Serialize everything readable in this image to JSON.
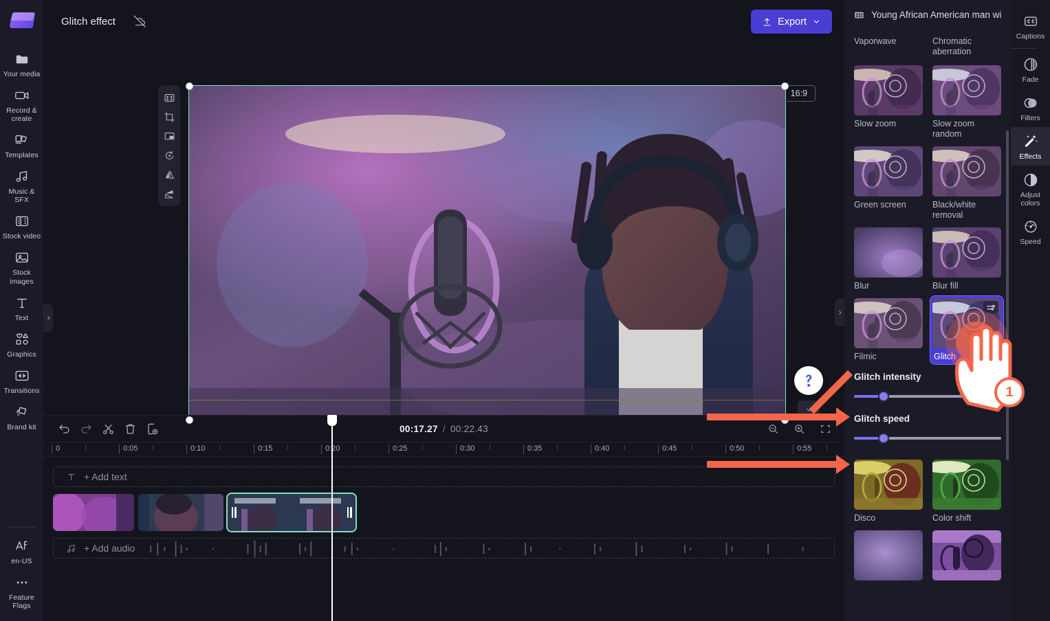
{
  "app": {
    "project_title": "Glitch effect",
    "export_label": "Export",
    "aspect_ratio": "16:9"
  },
  "left_rail": {
    "items": [
      {
        "label": "Your media",
        "icon": "media-folder-icon"
      },
      {
        "label": "Record & create",
        "icon": "video-camera-icon"
      },
      {
        "label": "Templates",
        "icon": "templates-icon"
      },
      {
        "label": "Music & SFX",
        "icon": "music-note-icon"
      },
      {
        "label": "Stock video",
        "icon": "film-strip-icon"
      },
      {
        "label": "Stock images",
        "icon": "image-icon"
      },
      {
        "label": "Text",
        "icon": "text-t-icon"
      },
      {
        "label": "Graphics",
        "icon": "shapes-icon"
      },
      {
        "label": "Transitions",
        "icon": "transitions-icon"
      },
      {
        "label": "Brand kit",
        "icon": "brand-kit-icon"
      }
    ],
    "bottom_items": [
      {
        "label": "en-US",
        "icon": "language-icon"
      },
      {
        "label": "Feature Flags",
        "icon": "ellipsis-icon"
      }
    ]
  },
  "preview_tools": [
    {
      "name": "fit-to-frame",
      "icon": "fit-frame-icon"
    },
    {
      "name": "crop",
      "icon": "crop-icon"
    },
    {
      "name": "picture-in-picture",
      "icon": "pip-icon"
    },
    {
      "name": "rotate",
      "icon": "rotate-icon"
    },
    {
      "name": "flip-horizontal",
      "icon": "flip-horizontal-icon"
    },
    {
      "name": "flip-vertical",
      "icon": "flip-vertical-icon"
    }
  ],
  "playback": {
    "controls": [
      {
        "name": "skip-to-start",
        "icon": "skip-previous-icon"
      },
      {
        "name": "rewind-5",
        "icon": "rewind-5-icon"
      },
      {
        "name": "play",
        "icon": "play-icon"
      },
      {
        "name": "forward-5",
        "icon": "forward-5-icon"
      },
      {
        "name": "skip-to-end",
        "icon": "skip-next-icon"
      }
    ],
    "fullscreen_icon": "fullscreen-icon"
  },
  "timeline": {
    "toolbar": [
      {
        "name": "undo",
        "icon": "undo-icon"
      },
      {
        "name": "redo",
        "icon": "redo-icon"
      },
      {
        "name": "split",
        "icon": "scissors-icon"
      },
      {
        "name": "delete",
        "icon": "trash-icon"
      },
      {
        "name": "duplicate",
        "icon": "duplicate-icon"
      }
    ],
    "current_time": "00:17.27",
    "separator": "/",
    "total_time": "00:22.43",
    "zoom_controls": [
      {
        "name": "zoom-out",
        "icon": "zoom-out-icon"
      },
      {
        "name": "zoom-in",
        "icon": "zoom-in-icon"
      },
      {
        "name": "zoom-fit",
        "icon": "zoom-fit-icon"
      }
    ],
    "ruler_ticks": [
      "0",
      "0:05",
      "0:10",
      "0:15",
      "0:20",
      "0:25",
      "0:30",
      "0:35",
      "0:40",
      "0:45",
      "0:50",
      "0:55"
    ],
    "add_text_label": "+ Add text",
    "add_audio_label": "+ Add audio",
    "clips": [
      {
        "name": "clip-1",
        "selected": false
      },
      {
        "name": "clip-2",
        "selected": false
      },
      {
        "name": "clip-3",
        "selected": true
      }
    ]
  },
  "right_panel": {
    "header_title": "Young African American man wi...",
    "header_icon": "film-strip-icon",
    "effects": [
      {
        "label": "Vaporwave",
        "selected": false,
        "thumb": "vaporwave"
      },
      {
        "label": "Chromatic aberration",
        "selected": false,
        "thumb": "chromatic"
      },
      {
        "label": "Slow zoom",
        "selected": false,
        "thumb": "slowzoom"
      },
      {
        "label": "Slow zoom random",
        "selected": false,
        "thumb": "slowzoomrandom"
      },
      {
        "label": "Green screen",
        "selected": false,
        "thumb": "greenscreen"
      },
      {
        "label": "Black/white removal",
        "selected": false,
        "thumb": "bwremoval"
      },
      {
        "label": "Blur",
        "selected": false,
        "thumb": "blur"
      },
      {
        "label": "Blur fill",
        "selected": false,
        "thumb": "blurfill"
      },
      {
        "label": "Filmic",
        "selected": false,
        "thumb": "filmic"
      },
      {
        "label": "Glitch",
        "selected": true,
        "thumb": "glitch"
      }
    ],
    "effects_after": [
      {
        "label": "Disco",
        "selected": false,
        "thumb": "disco"
      },
      {
        "label": "Color shift",
        "selected": false,
        "thumb": "colorshift"
      },
      {
        "label": "",
        "selected": false,
        "thumb": "blur2"
      },
      {
        "label": "",
        "selected": false,
        "thumb": "posterize"
      }
    ],
    "sliders": [
      {
        "label": "Glitch intensity",
        "value": 20
      },
      {
        "label": "Glitch speed",
        "value": 20
      }
    ]
  },
  "right_rail": {
    "items": [
      {
        "label": "Captions",
        "icon": "cc-icon",
        "active": false
      },
      {
        "label": "Fade",
        "icon": "fade-icon",
        "active": false
      },
      {
        "label": "Filters",
        "icon": "filters-icon",
        "active": false
      },
      {
        "label": "Effects",
        "icon": "effects-wand-icon",
        "active": true
      },
      {
        "label": "Adjust colors",
        "icon": "contrast-icon",
        "active": false
      },
      {
        "label": "Speed",
        "icon": "speedometer-icon",
        "active": false
      }
    ]
  },
  "annotations": {
    "step_number": "1",
    "help_label": "?",
    "accent_color": "#f4664a"
  }
}
